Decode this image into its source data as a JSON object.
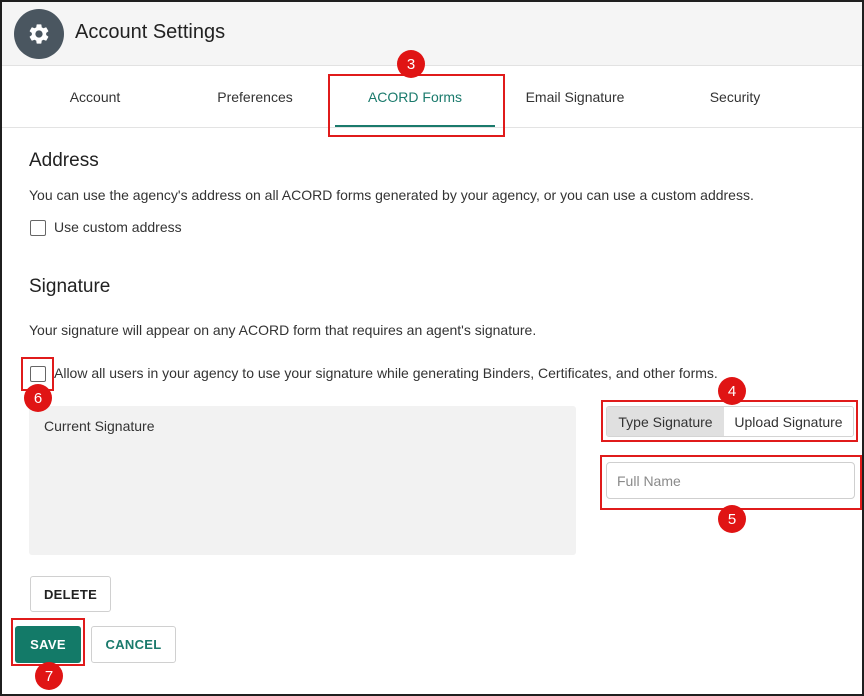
{
  "header": {
    "title": "Account Settings",
    "icon": "gear-icon"
  },
  "tabs": [
    {
      "label": "Account"
    },
    {
      "label": "Preferences"
    },
    {
      "label": "ACORD Forms",
      "active": true
    },
    {
      "label": "Email Signature"
    },
    {
      "label": "Security"
    }
  ],
  "address": {
    "heading": "Address",
    "description": "You can use the agency's address on all ACORD forms generated by your agency, or you can use a custom address.",
    "checkbox_label": "Use custom address",
    "checked": false
  },
  "signature": {
    "heading": "Signature",
    "description": "Your signature will appear on any ACORD form that requires an agent's signature.",
    "allow_label": "Allow all users in your agency to use your signature while generating Binders, Certificates, and other forms.",
    "allow_checked": false,
    "current_label": "Current Signature",
    "type_label": "Type Signature",
    "upload_label": "Upload Signature",
    "full_name_placeholder": "Full Name",
    "full_name_value": "",
    "delete_label": "DELETE"
  },
  "actions": {
    "save_label": "SAVE",
    "cancel_label": "CANCEL"
  },
  "annotations": {
    "b3": "3",
    "b4": "4",
    "b5": "5",
    "b6": "6",
    "b7": "7"
  },
  "colors": {
    "accent": "#1a7a6c",
    "save": "#137a68",
    "annotation": "#e01b1b"
  }
}
